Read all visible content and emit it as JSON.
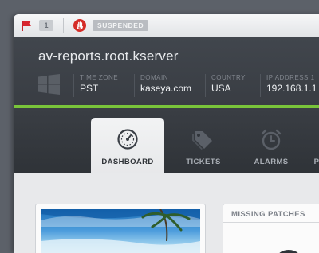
{
  "statusbar": {
    "flag_count": "1",
    "status": "SUSPENDED"
  },
  "header": {
    "hostname": "av-reports.root.kserver",
    "info": [
      {
        "label": "TIME ZONE",
        "value": "PST"
      },
      {
        "label": "DOMAIN",
        "value": "kaseya.com"
      },
      {
        "label": "COUNTRY",
        "value": "USA"
      },
      {
        "label": "IP ADDRESS 1",
        "value": "192.168.1.1"
      }
    ]
  },
  "tabs": [
    {
      "label": "DASHBOARD",
      "icon": "speedometer-icon",
      "active": true
    },
    {
      "label": "TICKETS",
      "icon": "tags-icon",
      "active": false
    },
    {
      "label": "ALARMS",
      "icon": "alarm-clock-icon",
      "active": false
    },
    {
      "label": "P",
      "icon": "",
      "active": false
    }
  ],
  "cards": {
    "missing_patches_title": "MISSING PATCHES"
  },
  "colors": {
    "accent_green": "#79c43a",
    "danger_red": "#d52c27"
  }
}
